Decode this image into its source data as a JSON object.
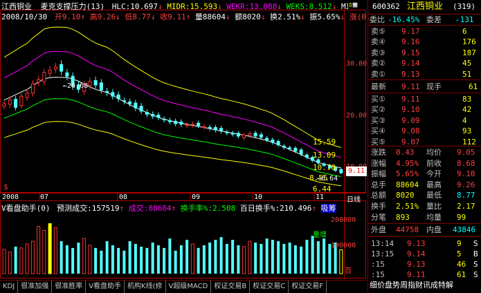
{
  "colors": {
    "up": "#ff3232",
    "down": "#54ffff",
    "ma_white": "#ffffff",
    "ma_yellow": "#ffff00",
    "ma_magenta": "#ff00ff",
    "ma_green": "#00ff00",
    "frame": "#b00000",
    "label": "#ff4040"
  },
  "header": {
    "title": "江西铜业",
    "indicator": "麦克支撑压力(13)",
    "hlc": "HLC:10.697",
    "midr": "MIDR:15.593",
    "wekr": "WEKR:13.088",
    "weks": "WEKS:8.512",
    "mids": "MIDS:",
    "date": "2008/10/30",
    "open": "开9.10",
    "high": "高9.26",
    "low": "低8.77",
    "close": "收9.11",
    "volume": "量88604",
    "amount": "额8020",
    "turnover": "换2.51%",
    "amplitude": "振5.65%",
    "change": "涨(0."
  },
  "price_axis": {
    "labels": [
      "30.00",
      "20.00",
      "10.00"
    ],
    "right_values": [
      "15.59",
      "13.09",
      "10.70",
      "8.55",
      "6.44"
    ],
    "current": "9.11",
    "high_mark": "26.68",
    "low_mark": "8.64",
    "low_mark_prefix": "↔"
  },
  "date_axis": {
    "labels": [
      "2008",
      "07",
      "08",
      "09",
      "10",
      "11"
    ],
    "period": "日线"
  },
  "volume_panel": {
    "title": "V看盘助手(0)",
    "forecast": "预测成交:157519",
    "volume": "成交:88604",
    "turn_rate": "换手率%:2.508",
    "day100": "百日换手%:210.496",
    "tag": "吸筹",
    "axis": [
      "200000",
      "100000"
    ],
    "legend": "量增",
    "unit": "百"
  },
  "chart_data": {
    "type": "candlestick",
    "price_range": [
      5.8,
      33.5
    ],
    "volume_range": [
      0,
      230000
    ],
    "closes": [
      20.2,
      20.8,
      19.6,
      21.4,
      21.9,
      23.4,
      24.1,
      25.2,
      25.6,
      26.1,
      25.4,
      24.6,
      23.0,
      22.5,
      23.2,
      23.8,
      23.2,
      22.4,
      22.0,
      21.4,
      21.0,
      20.6,
      20.2,
      19.5,
      19.0,
      18.5,
      18.2,
      18.0,
      17.6,
      17.3,
      17.0,
      16.9,
      16.8,
      16.9,
      16.7,
      16.5,
      16.3,
      16.0,
      15.8,
      15.5,
      15.3,
      15.0,
      15.2,
      15.4,
      15.0,
      14.8,
      14.4,
      14.0,
      13.6,
      13.2,
      13.0,
      12.6,
      12.1,
      11.6,
      11.1,
      10.7,
      10.3,
      9.9,
      9.5,
      9.11
    ],
    "volumes": [
      90000,
      80000,
      100000,
      95000,
      110000,
      120000,
      175000,
      160000,
      185000,
      170000,
      120000,
      105000,
      95000,
      115000,
      130000,
      105000,
      95000,
      85000,
      120000,
      105000,
      95000,
      85000,
      120000,
      110000,
      100000,
      95000,
      115000,
      105000,
      95000,
      130000,
      85000,
      105000,
      125000,
      110000,
      95000,
      105000,
      115000,
      125000,
      135000,
      110000,
      125000,
      105000,
      100000,
      120000,
      115000,
      110000,
      130000,
      125000,
      120000,
      110000,
      115000,
      105000,
      100000,
      125000,
      140000,
      120000,
      130000,
      110000,
      115000,
      88604
    ]
  },
  "quote": {
    "code": "600362",
    "name": "江西铜业",
    "count": "(319)",
    "weibi_label": "委比",
    "weibi": "-16.45%",
    "weicha_label": "委差",
    "weicha": "-131",
    "asks": [
      [
        "卖⑤",
        "9.17",
        "6"
      ],
      [
        "卖④",
        "9.16",
        "176"
      ],
      [
        "卖③",
        "9.15",
        "187"
      ],
      [
        "卖②",
        "9.14",
        "45"
      ],
      [
        "卖①",
        "9.13",
        "51"
      ]
    ],
    "last_label": "最新",
    "last": "9.11",
    "curvol_label": "现手",
    "curvol": "61",
    "bids": [
      [
        "买①",
        "9.11",
        "83"
      ],
      [
        "买②",
        "9.10",
        "42"
      ],
      [
        "买③",
        "9.09",
        "4"
      ],
      [
        "买④",
        "9.08",
        "93"
      ],
      [
        "买⑤",
        "9.07",
        "112"
      ]
    ],
    "stats": [
      [
        "涨跌",
        "0.43",
        "均价",
        "9.05"
      ],
      [
        "涨幅",
        "4.95%",
        "前收",
        "8.68"
      ],
      [
        "振幅",
        "5.65%",
        "今开",
        "9.10"
      ],
      [
        "总手",
        "88604",
        "最高",
        "9.26"
      ],
      [
        "总额",
        "8020",
        "最低",
        "8.77"
      ],
      [
        "换手",
        "2.51%",
        "量比",
        "2.17"
      ],
      [
        "分笔",
        "893",
        "均量",
        "99"
      ]
    ],
    "outer_label": "外盘",
    "outer": "44758",
    "inner_label": "内盘",
    "inner": "43846",
    "ticks": [
      [
        "13:14",
        "9.13",
        "9",
        "S"
      ],
      [
        "13:15",
        "9.14",
        "5",
        "B"
      ],
      [
        ":15",
        "9.13",
        "46",
        "S"
      ],
      [
        ":15",
        "9.11",
        "61",
        "S"
      ]
    ],
    "footer": "细价盘势周指财讯成特解"
  },
  "tabs": [
    "KDJ",
    "很准加强",
    "很准胜率",
    "V看盘助手",
    "机构K线(修",
    "V超级MACD",
    "权证交易B",
    "权证交易C",
    "权证交易F"
  ]
}
